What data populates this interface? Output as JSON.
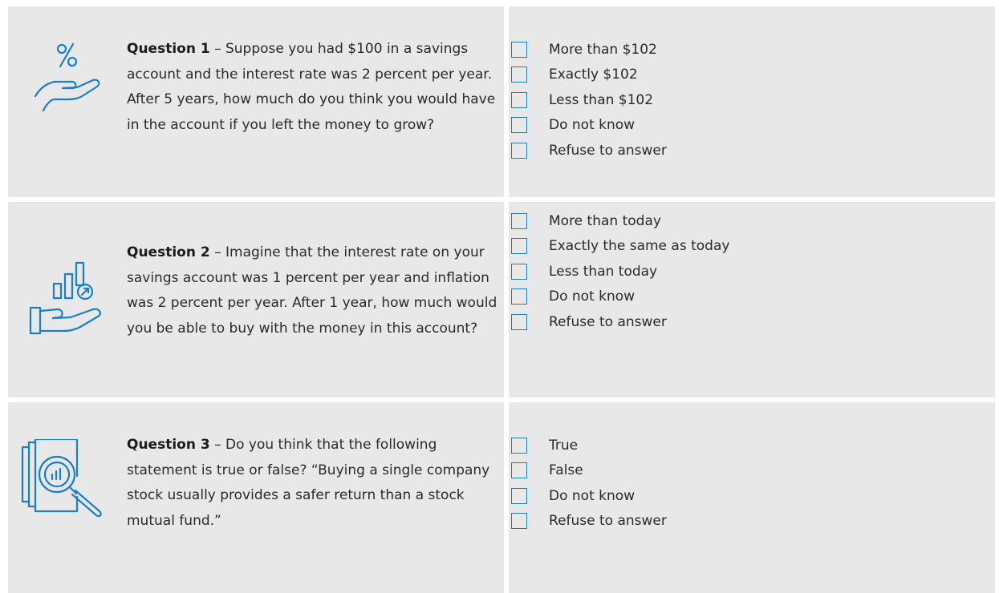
{
  "colors": {
    "accent": "#1a7fc4",
    "panel": "#e8e8e9"
  },
  "questions": [
    {
      "icon": "hand-percent-icon",
      "label": "Question 1",
      "text": " – Suppose you had $100 in a savings account and the interest rate was 2 percent per year. After 5 years, how much do you think you would have in the account if you left the money to grow?",
      "options": [
        "More than $102",
        "Exactly $102",
        "Less than $102",
        "Do not know",
        "Refuse to answer"
      ]
    },
    {
      "icon": "hand-growth-chart-icon",
      "label": "Question 2",
      "text": " – Imagine that the interest rate on your savings account was 1 percent per year and inflation was 2 percent per year. After 1 year, how much would you be able to buy with the money in this account?",
      "options": [
        "More than today",
        "Exactly the same as today",
        "Less than today",
        "Do not know",
        "Refuse to answer"
      ]
    },
    {
      "icon": "document-magnifier-chart-icon",
      "label": "Question 3",
      "text": " – Do you think that the following statement is true or false? “Buying a single company stock usually provides a safer return than a stock mutual fund.”",
      "options": [
        "True",
        "False",
        "Do not know",
        "Refuse to answer"
      ]
    }
  ]
}
